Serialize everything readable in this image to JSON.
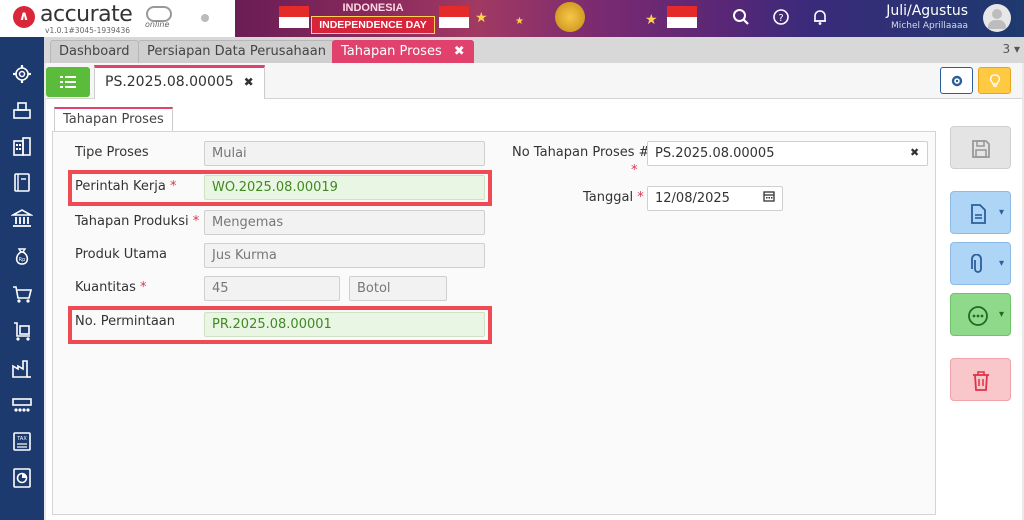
{
  "brand": {
    "name": "accurate",
    "sub": "online",
    "version": "v1.0.1#3045-1939436"
  },
  "banner": {
    "line1": "INDONESIA",
    "line2": "INDEPENDENCE DAY"
  },
  "user": {
    "period": "Juli/Agustus",
    "name": "Michel Aprillaaaa"
  },
  "tabs": [
    {
      "label": "Dashboard"
    },
    {
      "label": "Persiapan Data Perusahaan"
    },
    {
      "label": "Tahapan Proses",
      "close": "✖"
    }
  ],
  "tab_count": "3",
  "doc_tab": {
    "label": "PS.2025.08.00005",
    "close": "✖"
  },
  "subtab": "Tahapan Proses",
  "form": {
    "tipe_proses": {
      "label": "Tipe Proses",
      "value": "Mulai"
    },
    "perintah_kerja": {
      "label": "Perintah Kerja",
      "required": "*",
      "value": "WO.2025.08.00019"
    },
    "tahapan_produksi": {
      "label": "Tahapan Produksi",
      "required": "*",
      "value": "Mengemas"
    },
    "produk_utama": {
      "label": "Produk Utama",
      "value": "Jus Kurma"
    },
    "kuantitas": {
      "label": "Kuantitas",
      "required": "*",
      "value": "45",
      "unit": "Botol"
    },
    "no_permintaan": {
      "label": "No. Permintaan",
      "value": "PR.2025.08.00001"
    },
    "no_tahapan": {
      "label": "No Tahapan Proses #",
      "required": "*",
      "value": "PS.2025.08.00005",
      "clear": "✖"
    },
    "tanggal": {
      "label": "Tanggal",
      "required": "*",
      "value": "12/08/2025"
    }
  },
  "colors": {
    "accent": "#e0426d",
    "highlight": "#ee4b55",
    "sidebar": "#1d3a6e",
    "green_value": "#3f8a22"
  },
  "icons": {
    "sidebar": [
      "gear-icon",
      "inventory-icon",
      "building-icon",
      "ledger-icon",
      "bank-icon",
      "money-bag-icon",
      "cart-icon",
      "trolley-icon",
      "factory-icon",
      "production-line-icon",
      "tax-icon",
      "report-icon"
    ],
    "actions": [
      "save-icon",
      "document-icon",
      "attachment-icon",
      "more-icon",
      "trash-icon"
    ]
  }
}
